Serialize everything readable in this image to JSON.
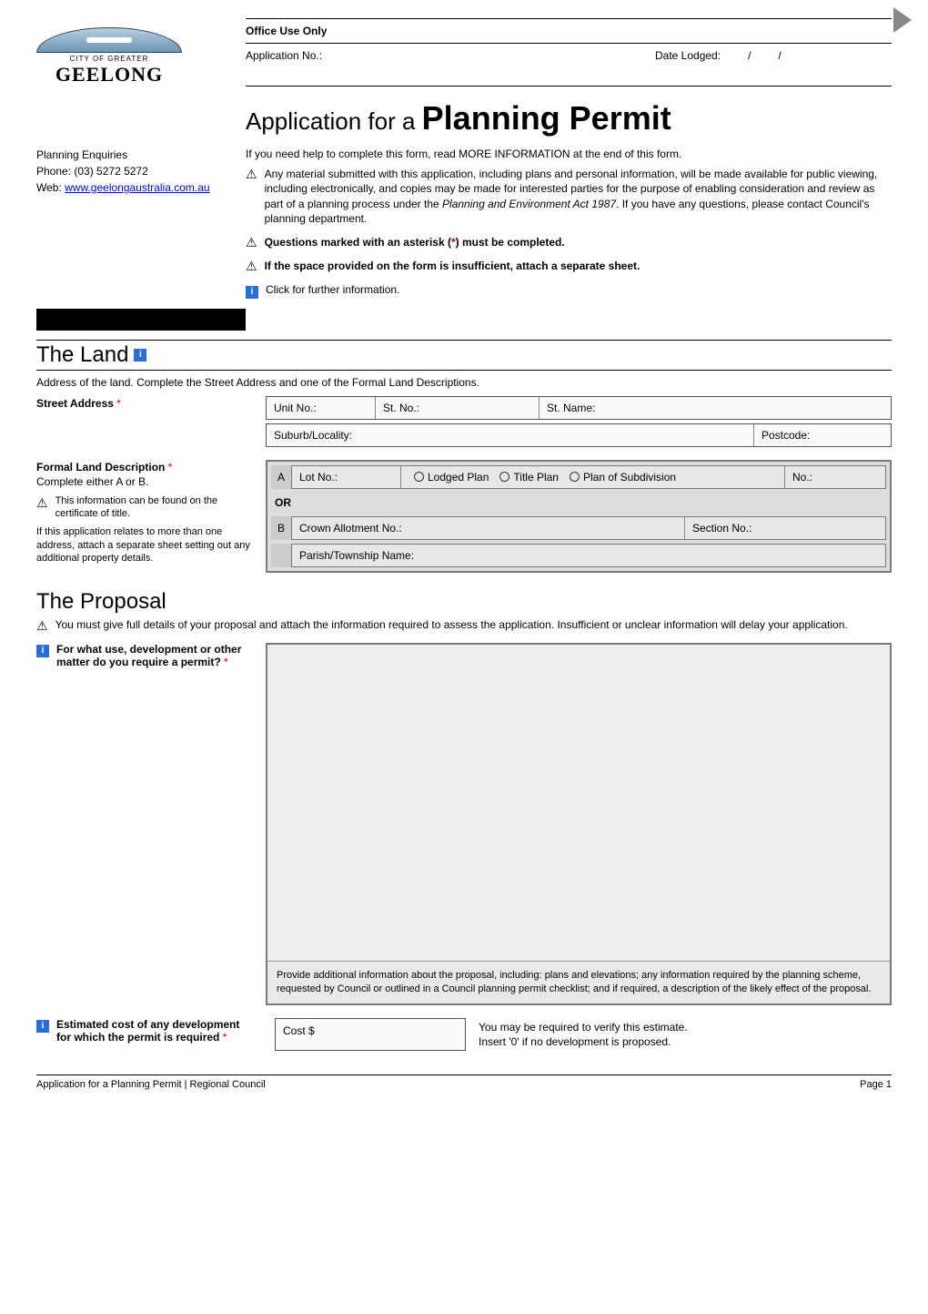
{
  "nav": {
    "next_alt": "next-page"
  },
  "logo": {
    "caption": "CITY OF GREATER",
    "name": "GEELONG"
  },
  "office": {
    "heading": "Office Use Only",
    "app_no_label": "Application No.:",
    "date_lodged_label": "Date Lodged:",
    "slash": "/"
  },
  "title": {
    "prefix": "Application for a ",
    "main": "Planning Permit"
  },
  "contact": {
    "heading": "Planning Enquiries",
    "phone": "Phone: (03) 5272 5272",
    "web_label": "Web:  ",
    "web_url": "www.geelongaustralia.com.au"
  },
  "intro": {
    "line1": "If you need help to complete this form, read MORE INFORMATION at the end of this form.",
    "para1a": "Any material submitted with this application, including plans and personal information, will be made available for public viewing, including electronically, and copies may be made for interested parties for the purpose of enabling consideration and review as part of a planning process under the ",
    "para1b": "Planning and Environment Act 1987",
    "para1c": ". If you have any questions, please contact Council's planning department.",
    "q_marked_a": "Questions marked with an asterisk (",
    "q_marked_star": "*",
    "q_marked_b": ") must be completed.",
    "space": "If the space provided on the form is insufficient, attach a separate sheet.",
    "click": "Click for further information."
  },
  "land": {
    "title": "The Land",
    "sub": "Address of the land. Complete the Street Address and one of the Formal Land Descriptions.",
    "street_label": "Street Address",
    "unit": "Unit No.:",
    "stno": "St. No.:",
    "stname": "St. Name:",
    "suburb": "Suburb/Locality:",
    "postcode": "Postcode:",
    "formal_label": "Formal Land Description",
    "formal_sub": "Complete either A or B.",
    "formal_note": "This information can be found on the certificate of title.",
    "formal_more": "If this application relates to more than one address, attach a separate sheet setting out any additional property details.",
    "A": "A",
    "B": "B",
    "OR": "OR",
    "lotno": "Lot No.:",
    "lodged": "Lodged Plan",
    "titleplan": "Title Plan",
    "pos": "Plan of Subdivision",
    "no": "No.:",
    "crown": "Crown Allotment No.:",
    "section": "Section No.:",
    "parish": "Parish/Township Name:"
  },
  "proposal": {
    "title": "The Proposal",
    "warn": "You must give full details of your proposal and attach the information required to assess the application. Insufficient or unclear information will delay your application.",
    "q1": "For what use, development or other matter do you require a permit?",
    "foot": "Provide additional information about the proposal, including: plans and elevations; any information required by the planning scheme, requested by Council or outlined in a Council planning permit checklist; and if required, a description of the likely effect of the proposal.",
    "cost_label": "Estimated cost of any development for which the permit is required",
    "cost_prefix": "Cost $",
    "cost_note1": "You may be required to verify this estimate.",
    "cost_note2": "Insert '0' if no development is proposed."
  },
  "footer": {
    "left": "Application for a Planning Permit  |  Regional Council",
    "right": "Page 1"
  }
}
